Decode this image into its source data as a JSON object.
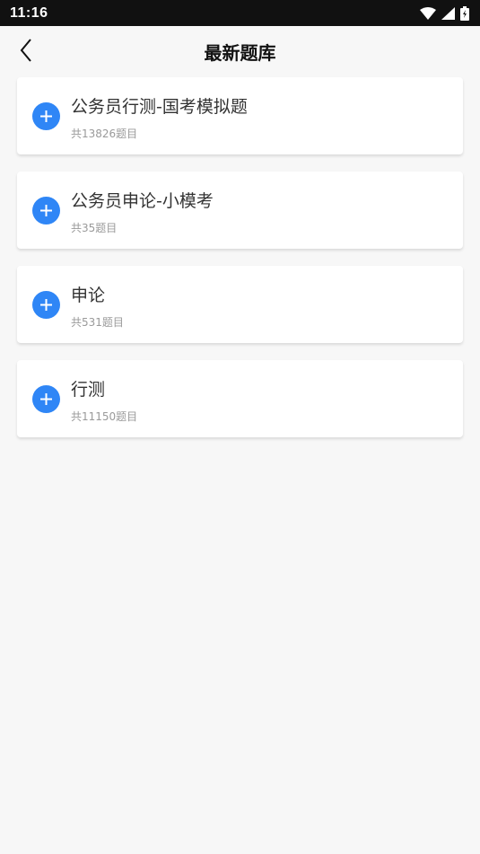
{
  "status_bar": {
    "time": "11:16",
    "icons": [
      "wifi-icon",
      "signal-icon",
      "battery-icon"
    ]
  },
  "header": {
    "title": "最新题库",
    "back_icon": "chevron-left-icon"
  },
  "banks": [
    {
      "title": "公务员行测-国考模拟题",
      "count": "共13826题目"
    },
    {
      "title": "公务员申论-小模考",
      "count": "共35题目"
    },
    {
      "title": "申论",
      "count": "共531题目"
    },
    {
      "title": "行测",
      "count": "共11150题目"
    }
  ],
  "colors": {
    "accent": "#2f86f6",
    "background": "#f7f7f7",
    "card": "#ffffff",
    "status_bar": "#111111"
  }
}
